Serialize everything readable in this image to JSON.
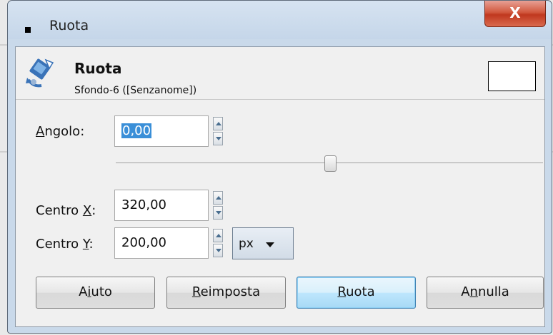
{
  "window": {
    "title": "Ruota",
    "close_label": "X"
  },
  "header": {
    "title": "Ruota",
    "subtitle": "Sfondo-6 ([Senzanome])"
  },
  "fields": {
    "angle": {
      "label_pre": "",
      "label_key": "A",
      "label_post": "ngolo:",
      "value": "0,00"
    },
    "center_x": {
      "label_pre": "Centro ",
      "label_key": "X",
      "label_post": ":",
      "value": "320,00"
    },
    "center_y": {
      "label_pre": "Centro ",
      "label_key": "Y",
      "label_post": ":",
      "value": "200,00"
    },
    "unit": {
      "selected": "px"
    }
  },
  "slider": {
    "angle_fraction": 0.5
  },
  "buttons": {
    "help": {
      "pre": "A",
      "key": "i",
      "post": "uto"
    },
    "reset": {
      "pre": "",
      "key": "R",
      "post": "eimposta"
    },
    "rotate": {
      "pre": "",
      "key": "R",
      "post": "uota"
    },
    "cancel": {
      "pre": "A",
      "key": "n",
      "post": "nulla"
    }
  },
  "colors": {
    "titlebar": "#c9d9ea",
    "close": "#c0381f",
    "selection": "#3a8fd8",
    "primary_border": "#3c7fb1"
  },
  "icons": {
    "window": "window-menu-icon",
    "tool": "rotate-tool-icon",
    "up": "spin-up-icon",
    "down": "spin-down-icon",
    "caret": "chevron-down-icon"
  }
}
